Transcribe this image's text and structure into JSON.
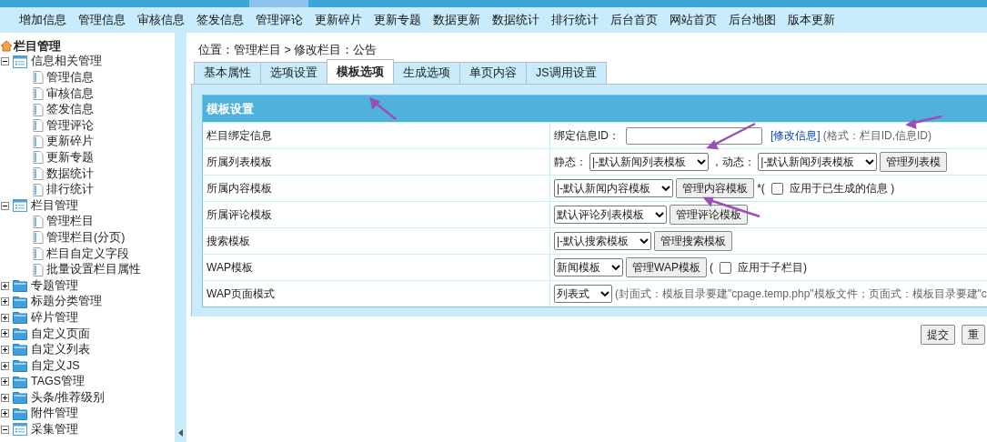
{
  "top_nav": [
    {
      "label": "增加信息",
      "selected": false
    },
    {
      "label": "管理信息",
      "selected": false
    },
    {
      "label": "审核信息",
      "selected": false
    },
    {
      "label": "签发信息",
      "selected": false
    },
    {
      "label": "管理评论",
      "selected": true
    },
    {
      "label": "更新碎片",
      "selected": false
    },
    {
      "label": "更新专题",
      "selected": false
    },
    {
      "label": "数据更新",
      "selected": false
    },
    {
      "label": "数据统计",
      "selected": false
    },
    {
      "label": "排行统计",
      "selected": false
    },
    {
      "label": "后台首页",
      "selected": false
    },
    {
      "label": "网站首页",
      "selected": false
    },
    {
      "label": "后台地图",
      "selected": false
    },
    {
      "label": "版本更新",
      "selected": false
    }
  ],
  "sidebar": {
    "root": "栏目管理",
    "tree": [
      {
        "label": "信息相关管理",
        "expanded": true,
        "children": [
          {
            "label": "管理信息"
          },
          {
            "label": "审核信息"
          },
          {
            "label": "签发信息"
          },
          {
            "label": "管理评论"
          },
          {
            "label": "更新碎片"
          },
          {
            "label": "更新专题"
          },
          {
            "label": "数据统计"
          },
          {
            "label": "排行统计"
          }
        ]
      },
      {
        "label": "栏目管理",
        "expanded": true,
        "children": [
          {
            "label": "管理栏目"
          },
          {
            "label": "管理栏目(分页)"
          },
          {
            "label": "栏目自定义字段"
          },
          {
            "label": "批量设置栏目属性"
          }
        ]
      },
      {
        "label": "专题管理",
        "expanded": false
      },
      {
        "label": "标题分类管理",
        "expanded": false
      },
      {
        "label": "碎片管理",
        "expanded": false
      },
      {
        "label": "自定义页面",
        "expanded": false
      },
      {
        "label": "自定义列表",
        "expanded": false
      },
      {
        "label": "自定义JS",
        "expanded": false
      },
      {
        "label": "TAGS管理",
        "expanded": false
      },
      {
        "label": "头条/推荐级别",
        "expanded": false
      },
      {
        "label": "附件管理",
        "expanded": false
      },
      {
        "label": "采集管理",
        "expanded": true
      }
    ]
  },
  "breadcrumb": "位置：管理栏目 > 修改栏目：公告",
  "tabs": [
    {
      "label": "基本属性",
      "selected": false
    },
    {
      "label": "选项设置",
      "selected": false
    },
    {
      "label": "模板选项",
      "selected": true
    },
    {
      "label": "生成选项",
      "selected": false
    },
    {
      "label": "单页内容",
      "selected": false
    },
    {
      "label": "JS调用设置",
      "selected": false
    }
  ],
  "table": {
    "title": "模板设置",
    "rows": [
      {
        "label": "栏目绑定信息",
        "controls": [
          {
            "kind": "text",
            "text": "绑定信息ID："
          },
          {
            "kind": "input"
          },
          {
            "kind": "link",
            "text": "[修改信息]"
          },
          {
            "kind": "note",
            "text": "(格式：栏目ID,信息ID)"
          }
        ]
      },
      {
        "label": "所属列表模板",
        "controls": [
          {
            "kind": "text",
            "text": "静态："
          },
          {
            "kind": "select",
            "value": "|-默认新闻列表模板"
          },
          {
            "kind": "text",
            "text": "，动态："
          },
          {
            "kind": "select",
            "value": "|-默认新闻列表模板"
          },
          {
            "kind": "button",
            "text": "管理列表模"
          }
        ]
      },
      {
        "label": "所属内容模板",
        "controls": [
          {
            "kind": "select",
            "value": "|-默认新闻内容模板"
          },
          {
            "kind": "button",
            "text": "管理内容模板"
          },
          {
            "kind": "text",
            "text": "*("
          },
          {
            "kind": "checkbox",
            "checked": false
          },
          {
            "kind": "text",
            "text": "应用于已生成的信息 )"
          }
        ]
      },
      {
        "label": "所属评论模板",
        "controls": [
          {
            "kind": "select",
            "value": "默认评论列表模板"
          },
          {
            "kind": "button",
            "text": "管理评论模板"
          }
        ]
      },
      {
        "label": "搜索模板",
        "controls": [
          {
            "kind": "select",
            "value": "|-默认搜索模板"
          },
          {
            "kind": "button",
            "text": "管理搜索模板"
          }
        ]
      },
      {
        "label": "WAP模板",
        "controls": [
          {
            "kind": "select",
            "value": "新闻模板"
          },
          {
            "kind": "button",
            "text": "管理WAP模板"
          },
          {
            "kind": "text",
            "text": "("
          },
          {
            "kind": "checkbox",
            "checked": false
          },
          {
            "kind": "text",
            "text": "应用于子栏目)"
          }
        ]
      },
      {
        "label": "WAP页面模式",
        "controls": [
          {
            "kind": "select",
            "value": "列表式"
          },
          {
            "kind": "note",
            "text": "(封面式：模板目录要建\"cpage.temp.php\"模板文件；页面式：模板目录要建\"c"
          }
        ]
      }
    ]
  },
  "actions": [
    "提交",
    "重"
  ]
}
